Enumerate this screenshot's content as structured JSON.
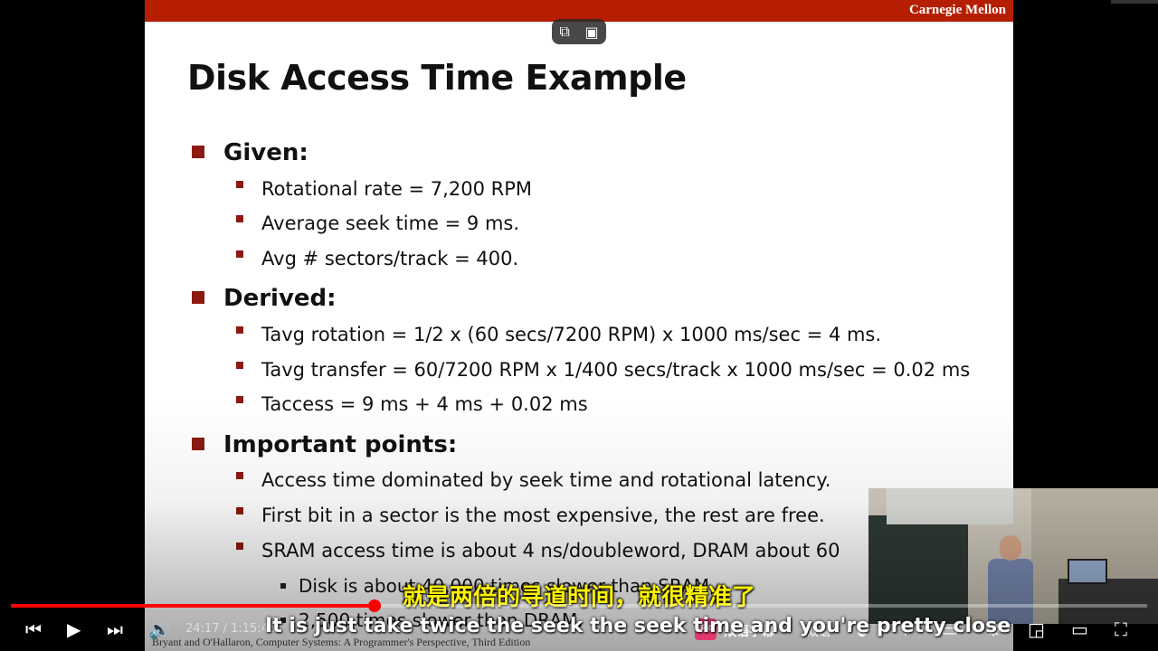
{
  "slide": {
    "brand": "Carnegie Mellon",
    "title": "Disk Access Time Example",
    "sections": [
      {
        "heading": "Given:",
        "items": [
          "Rotational rate = 7,200 RPM",
          "Average seek time = 9 ms.",
          "Avg # sectors/track = 400."
        ]
      },
      {
        "heading": "Derived:",
        "items": [
          "Tavg rotation = 1/2 x (60 secs/7200 RPM) x 1000 ms/sec = 4 ms.",
          "Tavg transfer = 60/7200 RPM x 1/400 secs/track x 1000 ms/sec = 0.02 ms",
          "Taccess  = 9 ms + 4 ms + 0.02 ms"
        ]
      },
      {
        "heading": "Important points:",
        "items": [
          "Access time dominated by seek time and rotational latency.",
          "First bit in a sector is the most expensive, the rest are free.",
          "SRAM access time is about  4 ns/doubleword, DRAM about  60"
        ],
        "subitems": [
          "Disk is about 40,000 times slower than SRAM,",
          "2,500 times slower then DRAM."
        ]
      }
    ],
    "footer": "Bryant and O'Hallaron, Computer Systems: A Programmer's Perspective, Third Edition"
  },
  "subtitles": {
    "zh": "就是两倍的寻道时间，就很精准了",
    "en": "It is just take twice the seek the seek time and you're pretty close"
  },
  "player": {
    "time_current": "24:17",
    "time_total": "1:15:46",
    "time_display": "24:17 / 1:15:46",
    "progress": 0.32,
    "extension_badge": "中A",
    "extension_label": "双语字幕",
    "language_label": "双语",
    "icons": {
      "prev": "skip-previous-icon",
      "play": "play-icon",
      "next": "skip-next-icon",
      "volume": "volume-icon",
      "captions": "captions-icon",
      "settings": "gear-icon",
      "miniplayer": "miniplayer-icon",
      "theater": "theater-mode-icon",
      "fullscreen": "fullscreen-icon"
    }
  }
}
